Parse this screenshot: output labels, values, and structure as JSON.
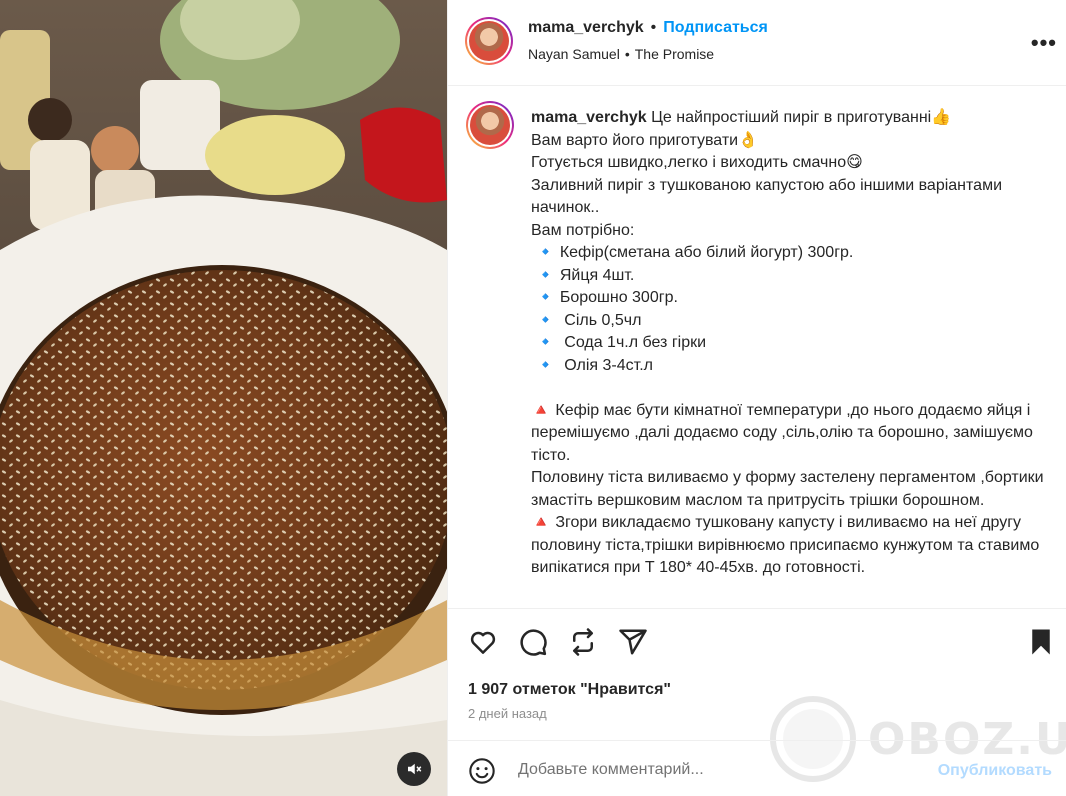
{
  "post": {
    "username": "mama_verchyk",
    "dot": "•",
    "follow_label": "Подписаться",
    "audio_artist": "Nayan Samuel",
    "audio_sep": "•",
    "audio_title": "The Promise",
    "more_label": "•••"
  },
  "caption": {
    "username": "mama_verchyk",
    "text": " Це найпростіший пиріг в приготуванні👍\nВам варто його приготувати👌\nГотується швидко,легко і виходить смачно😋\nЗаливний пиріг з тушкованою капустою або іншими варіантами начинок..\nВам потрібно:\n 🔹 Кефір(сметана або білий йогурт) 300гр.\n 🔹 Яйця 4шт.\n 🔹 Борошно 300гр.\n 🔹  Сіль 0,5чл\n 🔹  Сода 1ч.л без гірки\n 🔹  Олія 3-4ст.л\n\n🔺 Кефір має бути кімнатної температури ,до нього додаємо яйця і перемішуємо ,далі додаємо соду ,сіль,олію та борошно, замішуємо тісто.\nПоловину тіста виливаємо у форму застелену пергаментом ,бортики змастіть вершковим маслом та притрусіть трішки борошном.\n🔺 Згори викладаємо тушковану капусту і виливаємо на неї другу половину тіста,трішки вирівнюємо присипаємо кунжутом та ставимо випікатися при Т 180* 40-45хв. до готовності."
  },
  "stats": {
    "likes": "1 907 отметок \"Нравится\"",
    "date": "2 дней назад"
  },
  "watermark": {
    "text": "OBOZ.UA"
  },
  "comment": {
    "placeholder": "Добавьте комментарий...",
    "publish_label": "Опубликовать"
  },
  "icons": {
    "like": "heart-icon",
    "comment": "comment-icon",
    "repost": "repost-icon",
    "share": "share-icon",
    "save": "bookmark-icon",
    "emoji": "emoji-icon",
    "mute": "speaker-muted-icon"
  },
  "colors": {
    "link": "#0095f6",
    "publish_disabled": "#b3dbff",
    "muted_text": "#8e8e8e"
  }
}
